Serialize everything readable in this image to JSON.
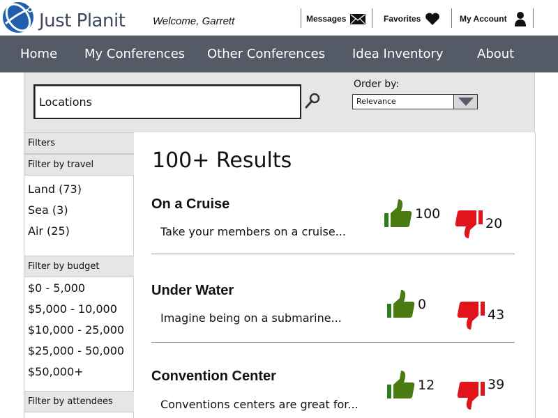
{
  "header": {
    "brand": "Just Planit",
    "welcome": "Welcome, Garrett",
    "messages_label": "Messages",
    "favorites_label": "Favorites",
    "account_label": "My Account"
  },
  "nav": {
    "items": [
      "Home",
      "My Conferences",
      "Other Conferences",
      "Idea Inventory",
      "About"
    ]
  },
  "search": {
    "value": "Locations",
    "orderby_label": "Order by:",
    "orderby_value": "Relevance"
  },
  "sidebar": {
    "filters_label": "Filters",
    "travel": {
      "label": "Filter by travel",
      "options": [
        "Land (73)",
        "Sea (3)",
        "Air (25)"
      ]
    },
    "budget": {
      "label": "Filter by budget",
      "options": [
        "$0 - 5,000",
        "$5,000 - 10,000",
        "$10,000 - 25,000",
        "$25,000 - 50,000",
        "$50,000+"
      ]
    },
    "attendees": {
      "label": "Filter by attendees"
    }
  },
  "results": {
    "count_label": "100+ Results",
    "items": [
      {
        "title": "On a Cruise",
        "description": "Take your members on a cruise...",
        "up": "100",
        "down": "20"
      },
      {
        "title": "Under Water",
        "description": "Imagine being on a submarine...",
        "up": "0",
        "down": "43"
      },
      {
        "title": "Convention Center",
        "description": "Conventions centers are great for...",
        "up": "12",
        "down": "39"
      }
    ]
  },
  "colors": {
    "nav_bg": "#555b66",
    "panel_bg": "#e6e6e6",
    "thumb_up": "#4a7a12",
    "thumb_down": "#e0141a",
    "logo_blue": "#1f5fae"
  },
  "icons": [
    "logo-globe-icon",
    "envelope-icon",
    "heart-icon",
    "person-icon",
    "search-icon",
    "dropdown-arrow-icon",
    "thumbs-up-icon",
    "thumbs-down-icon"
  ]
}
